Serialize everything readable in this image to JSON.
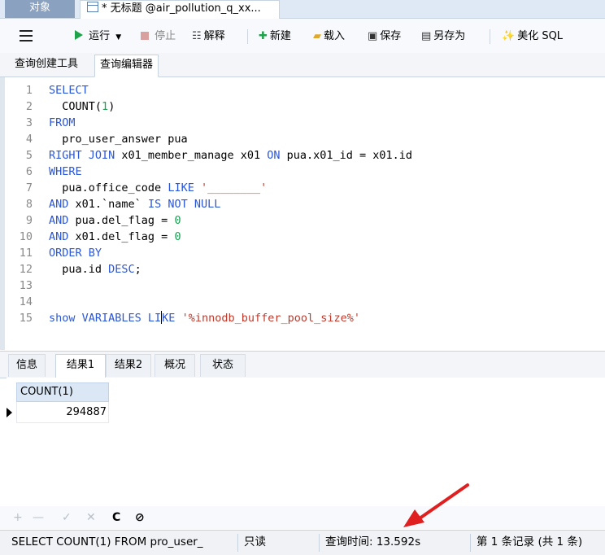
{
  "tabs": {
    "objects": "对象",
    "query": "* 无标题 @air_pollution_q_xx..."
  },
  "toolbar": {
    "run": "运行",
    "stop": "停止",
    "explain": "解释",
    "new": "新建",
    "load": "载入",
    "save": "保存",
    "save_as": "另存为",
    "beautify": "美化 SQL"
  },
  "subtabs": {
    "builder": "查询创建工具",
    "editor": "查询编辑器"
  },
  "code": {
    "l1_kw": "SELECT",
    "l2_a": "  COUNT",
    "l2_b": "(",
    "l2_num": "1",
    "l2_c": ")",
    "l3_kw": "FROM",
    "l4": "  pro_user_answer pua",
    "l5_kw1": "RIGHT JOIN",
    "l5_a": " x01_member_manage x01 ",
    "l5_kw2": "ON",
    "l5_b": " pua.x01_id = x01.id",
    "l6_kw": "WHERE",
    "l7_a": "  pua.office_code ",
    "l7_kw": "LIKE",
    "l7_str": " '________'",
    "l8_kw1": "AND",
    "l8_a": " x01.`name` ",
    "l8_kw2": "IS NOT NULL",
    "l9_kw": "AND",
    "l9_a": " pua.del_flag = ",
    "l9_num": "0",
    "l10_kw": "AND",
    "l10_a": " x01.del_flag = ",
    "l10_num": "0",
    "l11_kw": "ORDER BY",
    "l12_a": "  pua.id ",
    "l12_kw": "DESC",
    "l12_b": ";",
    "l15_a": "show VARIABLES LI",
    "l15_b": "KE",
    "l15_str": " '%innodb_buffer_pool_size%'"
  },
  "result_tabs": [
    "信息",
    "结果1",
    "结果2",
    "概况",
    "状态"
  ],
  "result": {
    "column": "COUNT(1)",
    "value": "294887"
  },
  "gridbar": {
    "add": "+",
    "remove": "—",
    "apply": "✓",
    "cancel": "✕",
    "refresh": "C",
    "stop": "⊘"
  },
  "status": {
    "sql": "SELECT   COUNT(1) FROM   pro_user_",
    "readonly": "只读",
    "query_time": "查询时间: 13.592s",
    "records": "第 1 条记录 (共 1 条)"
  },
  "colors": {
    "keyword": "#2a56d9",
    "string": "#c0392b",
    "number": "#16a050",
    "annotation_arrow": "#e02020"
  }
}
